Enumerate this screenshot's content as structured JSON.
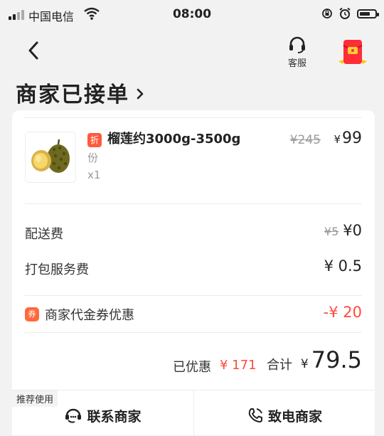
{
  "status_bar": {
    "carrier": "中国电信",
    "time": "08:00"
  },
  "header": {
    "customer_service_label": "客服"
  },
  "order_status": {
    "title": "商家已接单"
  },
  "product": {
    "discount_badge": "折",
    "name": "榴莲约3000g-3500g",
    "name_continued": "份",
    "quantity": "x1",
    "original_price": "¥245",
    "price_yen": "¥",
    "price": "99"
  },
  "fees": {
    "delivery_label": "配送费",
    "delivery_original": "¥5",
    "delivery_value": "¥0",
    "packing_label": "打包服务费",
    "packing_value": "¥ 0.5"
  },
  "coupon": {
    "icon_text": "券",
    "label": "商家代金券优惠",
    "value": "-¥ 20"
  },
  "summary": {
    "saved_label": "已优惠",
    "saved_value": "¥ 171",
    "total_label": "合计",
    "total_yen": "¥",
    "total_value": "79.5"
  },
  "actions": {
    "recommend_tag": "推荐使用",
    "contact_merchant": "联系商家",
    "call_merchant": "致电商家"
  },
  "colors": {
    "accent_red": "#ff4a3a",
    "badge_orange": "#ff5a3c"
  }
}
